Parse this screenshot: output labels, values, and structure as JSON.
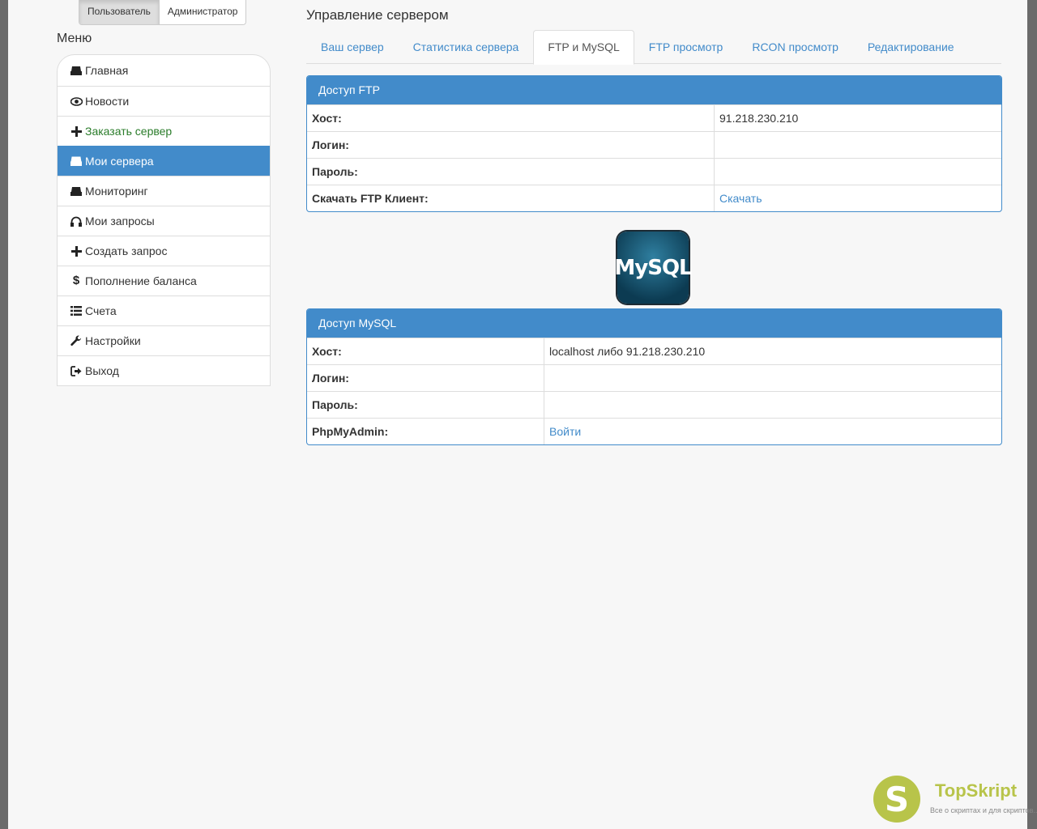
{
  "role_switch": {
    "user_label": "Пользователь",
    "admin_label": "Администратор"
  },
  "menu": {
    "title": "Меню",
    "items": [
      {
        "label": "Главная",
        "icon": "hdd-icon"
      },
      {
        "label": "Новости",
        "icon": "eye-icon"
      },
      {
        "label": "Заказать сервер",
        "icon": "plus-icon"
      },
      {
        "label": "Мои сервера",
        "icon": "hdd-icon"
      },
      {
        "label": "Мониторинг",
        "icon": "hdd-icon"
      },
      {
        "label": "Мои запросы",
        "icon": "headphones-icon"
      },
      {
        "label": "Создать запрос",
        "icon": "plus-icon"
      },
      {
        "label": "Пополнение баланса",
        "icon": "dollar-icon"
      },
      {
        "label": "Счета",
        "icon": "list-icon"
      },
      {
        "label": "Настройки",
        "icon": "wrench-icon"
      },
      {
        "label": "Выход",
        "icon": "logout-icon"
      }
    ]
  },
  "main": {
    "title": "Управление сервером",
    "tabs": [
      "Ваш сервер",
      "Статистика сервера",
      "FTP и MySQL",
      "FTP просмотр",
      "RCON просмотр",
      "Редактирование"
    ]
  },
  "ftp_panel": {
    "heading": "Доступ FTP",
    "rows": [
      {
        "label": "Хост:",
        "value": "91.218.230.210"
      },
      {
        "label": "Логин:",
        "value": ""
      },
      {
        "label": "Пароль:",
        "value": ""
      },
      {
        "label": "Скачать FTP Клиент:",
        "link": "Скачать"
      }
    ]
  },
  "mysql_logo_text": "MySQL",
  "mysql_panel": {
    "heading": "Доступ MySQL",
    "rows": [
      {
        "label": "Хост:",
        "value": "localhost либо 91.218.230.210"
      },
      {
        "label": "Логин:",
        "value": ""
      },
      {
        "label": "Пароль:",
        "value": ""
      },
      {
        "label": "PhpMyAdmin:",
        "link": "Войти"
      }
    ]
  },
  "watermark": {
    "title": "TopSkript",
    "subtitle": "Все о скриптах и для скриптов...",
    "logo_letter": "S"
  },
  "colors": {
    "accent": "#428bca",
    "green": "#2a7c2a",
    "watermark": "#b8c44a"
  }
}
